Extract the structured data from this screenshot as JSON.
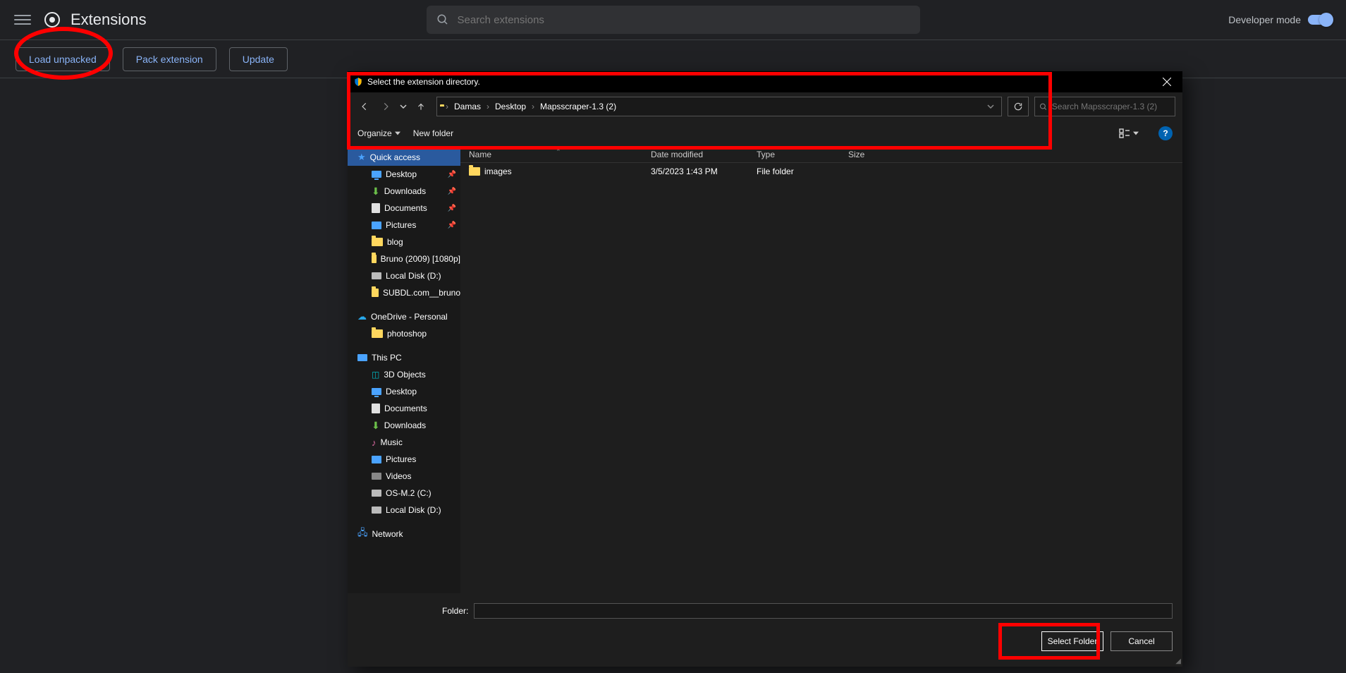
{
  "header": {
    "title": "Extensions",
    "search_placeholder": "Search extensions",
    "dev_mode_label": "Developer mode"
  },
  "toolbar": {
    "load_unpacked": "Load unpacked",
    "pack_extension": "Pack extension",
    "update": "Update"
  },
  "dialog": {
    "title": "Select the extension directory.",
    "breadcrumb": [
      "Damas",
      "Desktop",
      "Mapsscraper-1.3 (2)"
    ],
    "search_placeholder": "Search Mapsscraper-1.3 (2)",
    "organize": "Organize",
    "new_folder": "New folder",
    "help": "?",
    "columns": {
      "name": "Name",
      "date": "Date modified",
      "type": "Type",
      "size": "Size"
    },
    "rows": [
      {
        "name": "images",
        "date": "3/5/2023 1:43 PM",
        "type": "File folder",
        "size": ""
      }
    ],
    "tree": {
      "quick_access": "Quick access",
      "qa_items": [
        {
          "icon": "desktop",
          "label": "Desktop",
          "pin": true
        },
        {
          "icon": "download",
          "label": "Downloads",
          "pin": true
        },
        {
          "icon": "doc",
          "label": "Documents",
          "pin": true
        },
        {
          "icon": "pic",
          "label": "Pictures",
          "pin": true
        },
        {
          "icon": "folder",
          "label": "blog",
          "pin": false
        },
        {
          "icon": "folder",
          "label": "Bruno (2009) [1080p]",
          "pin": false
        },
        {
          "icon": "disk",
          "label": "Local Disk (D:)",
          "pin": false
        },
        {
          "icon": "folder",
          "label": "SUBDL.com__bruno",
          "pin": false
        }
      ],
      "onedrive": "OneDrive - Personal",
      "od_items": [
        {
          "icon": "folder",
          "label": "photoshop"
        }
      ],
      "thispc": "This PC",
      "pc_items": [
        {
          "icon": "3d",
          "label": "3D Objects"
        },
        {
          "icon": "desktop",
          "label": "Desktop"
        },
        {
          "icon": "doc",
          "label": "Documents"
        },
        {
          "icon": "download",
          "label": "Downloads"
        },
        {
          "icon": "music",
          "label": "Music"
        },
        {
          "icon": "pic",
          "label": "Pictures"
        },
        {
          "icon": "video",
          "label": "Videos"
        },
        {
          "icon": "disk",
          "label": "OS-M.2 (C:)"
        },
        {
          "icon": "disk",
          "label": "Local Disk (D:)"
        }
      ],
      "network": "Network"
    },
    "footer": {
      "folder_label": "Folder:",
      "folder_value": "",
      "select": "Select Folder",
      "cancel": "Cancel"
    }
  }
}
